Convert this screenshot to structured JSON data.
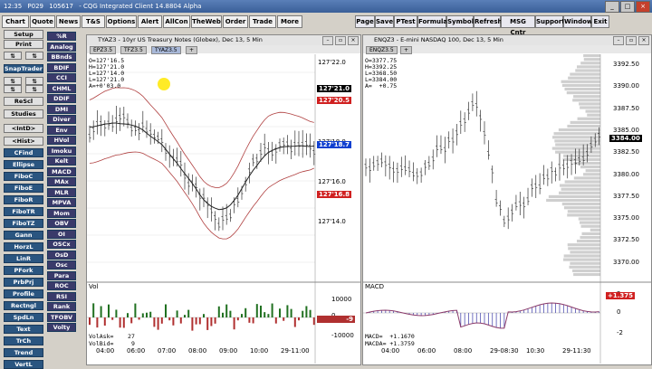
{
  "titlebar": {
    "time": "12:35",
    "code": "P029",
    "acct": "105617",
    "title": "- CQG Integrated Client 14.8804 Alpha"
  },
  "toolbar_left": [
    "Chart",
    "Quote",
    "News",
    "T&S",
    "Options",
    "Alert",
    "AllCon",
    "TheWeb",
    "Order",
    "Trade",
    "More"
  ],
  "toolbar_right": [
    "Page",
    "Save",
    "PTest",
    "Formula",
    "Symbol",
    "Refresh",
    "MSG Cntr",
    "Support",
    "Window",
    "Exit"
  ],
  "sidebar_left": [
    "Setup",
    "Print",
    "SnapTrader",
    "ReScl",
    "Studies",
    "<IntD>",
    "<Hist>",
    "CFind",
    "Ellipse",
    "FiboC",
    "FiboE",
    "FiboR",
    "FiboTR",
    "FiboTZ",
    "Gann",
    "HorzL",
    "LinR",
    "PFork",
    "PrbPrj",
    "Profile",
    "Rectngl",
    "SpdLn",
    "Text",
    "TrCh",
    "Trend",
    "VertL"
  ],
  "sidebar_right": [
    "%R",
    "Analog",
    "BBnds",
    "BDIF",
    "CCI",
    "CHML",
    "DDIF",
    "DMI",
    "Diver",
    "Env",
    "HVol",
    "Imoku",
    "Kelt",
    "MACD",
    "MAx",
    "MLR",
    "MPVA",
    "Mom",
    "OBV",
    "OI",
    "OSCx",
    "OsD",
    "Osc",
    "Para",
    "ROC",
    "RSI",
    "Rank",
    "TFOBV",
    "Volty"
  ],
  "chart1": {
    "title": "TYAZ3 - 10yr US Treasury Notes (Globex), Dec 13, 5 Min",
    "tabs": [
      "EPZ3.5",
      "TFZ3.5",
      "TYAZ3.5",
      "+"
    ],
    "ohlc": "O=127'16.5\nH=127'21.0\nL=127'14.0\nL=127'21.0\nA=+0'03.0",
    "yticks": [
      "127'22.0",
      "127'20.0",
      "127'18.0",
      "127'16.0",
      "127'14.0"
    ],
    "boxes": [
      {
        "label": "127'21.0",
        "color": "#000000"
      },
      {
        "label": "127'20.5",
        "color": "#d02020"
      },
      {
        "label": "127'18.7",
        "color": "#1040d0"
      },
      {
        "label": "127'16.8",
        "color": "#d02020"
      }
    ],
    "vol_label": "Vol",
    "vol_ticks": [
      "10000",
      "0",
      "-10000"
    ],
    "vol_box": "-9",
    "volask": "VolAsk=    27",
    "volbid": "VolBid=     9",
    "xticks": [
      "04:00",
      "06:00",
      "07:00",
      "08:00",
      "09:00",
      "10:00",
      "29-11:00"
    ]
  },
  "chart2": {
    "title": "ENQZ3 - E-mini NASDAQ 100, Dec 13, 5 Min",
    "tabs": [
      "ENQZ3.5",
      "+"
    ],
    "ohlc": "O=3377.75\nH=3392.25\nL=3368.50\nL=3384.00\nA=  +0.75",
    "yticks": [
      "3392.50",
      "3390.00",
      "3387.50",
      "3385.00",
      "3382.50",
      "3380.00",
      "3377.50",
      "3375.00",
      "3372.50",
      "3370.00"
    ],
    "box": "3384.00",
    "macd_label": "MACD",
    "macd_ticks": [
      "2",
      "0",
      "-2"
    ],
    "macd_box": "+1.375",
    "macd_val": "MACD=  +1.1670",
    "macda_val": "MACDA= +1.3759",
    "xticks": [
      "04:00",
      "06:00",
      "08:00",
      "29-08:30",
      "10:30",
      "29-11:30"
    ]
  }
}
